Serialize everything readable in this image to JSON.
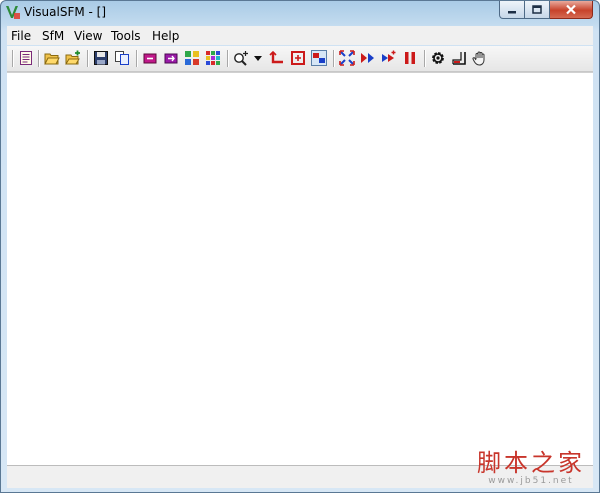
{
  "window": {
    "title": "VisualSFM - []"
  },
  "menubar": {
    "items": [
      "File",
      "SfM",
      "View",
      "Tools",
      "Help"
    ]
  },
  "toolbar": {
    "icons": [
      "log-icon",
      "open-icon",
      "open-add-icon",
      "save-icon",
      "copy-icon",
      "pair-icon",
      "match-icon",
      "grid-icon",
      "palette-icon",
      "zoom-icon",
      "dropdown-arrow-icon",
      "axis-icon",
      "frame-icon",
      "camera-pair-icon",
      "expand-icon",
      "forward-icon",
      "add-point-icon",
      "pause-icon",
      "gear-icon",
      "ruler-icon",
      "hand-icon"
    ]
  },
  "watermark": {
    "text": "脚本之家",
    "url": "www.jb51.net"
  },
  "colors": {
    "titlebar": "#c3dbef",
    "close_button": "#c7432b",
    "accent_red": "#cc1a1a",
    "accent_blue": "#1a3fc8"
  }
}
